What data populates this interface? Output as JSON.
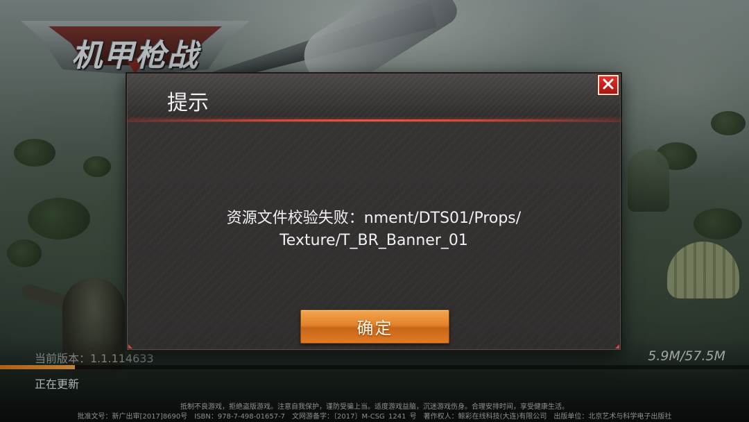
{
  "game": {
    "logo_text": "机甲枪战"
  },
  "dialog": {
    "title": "提示",
    "message_line1": "资源文件校验失败：nment/DTS01/Props/",
    "message_line2": "Texture/T_BR_Banner_01",
    "confirm_label": "确定",
    "close_icon": "close-x-icon"
  },
  "hud": {
    "version_label": "当前版本：1.1.114633",
    "status_text": "正在更新",
    "download_text": "5.9M/57.5M",
    "download_progress": 0.1
  },
  "footer": {
    "health_notice": "抵制不良游戏，拒绝盗版游戏。注意自我保护，谨防受骗上当。适度游戏益脑，沉迷游戏伤身。合理安排时间，享受健康生活。",
    "license_info": "批准文号：新广出审[2017]8690号　ISBN：978-7-498-01657-7　文网游备字：〔2017〕M-CSG 1241 号　著作权人：鲸彩在线科技(大连)有限公司　出版单位：北京艺术与科学电子出版社"
  },
  "colors": {
    "accent_red": "#d24a3a",
    "button_orange": "#e3832a",
    "dialog_bg": "#343131"
  }
}
